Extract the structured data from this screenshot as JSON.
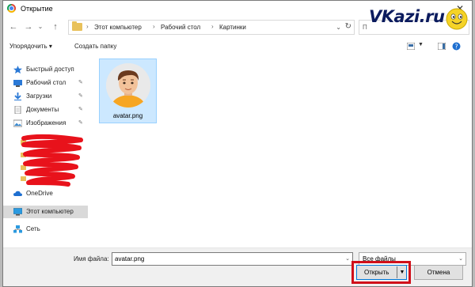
{
  "window": {
    "title": "Открытие",
    "close_glyph": "✕"
  },
  "address": {
    "crumbs": [
      "Этот компьютер",
      "Рабочий стол",
      "Картинки"
    ],
    "sep": "›",
    "search_placeholder": "П"
  },
  "toolbar": {
    "organize": "Упорядочить ▾",
    "new_folder": "Создать папку"
  },
  "nav": {
    "items": [
      {
        "label": "Быстрый доступ",
        "icon": "star-icon"
      },
      {
        "label": "Рабочий стол",
        "icon": "desktop-icon",
        "pinned": true
      },
      {
        "label": "Загрузки",
        "icon": "download-icon",
        "pinned": true
      },
      {
        "label": "Документы",
        "icon": "document-icon",
        "pinned": true
      },
      {
        "label": "Изображения",
        "icon": "pictures-icon",
        "pinned": true
      },
      {
        "label": "OneDrive",
        "icon": "cloud-icon"
      },
      {
        "label": "Этот компьютер",
        "icon": "computer-icon",
        "selected": true
      },
      {
        "label": "Сеть",
        "icon": "network-icon"
      }
    ],
    "pin_glyph": "📌"
  },
  "files": [
    {
      "name": "avatar.png",
      "selected": true
    }
  ],
  "bottom": {
    "filename_label": "Имя файла:",
    "filename_value": "avatar.png",
    "filter_value": "Все файлы",
    "open_label": "Открыть",
    "cancel_label": "Отмена"
  },
  "watermark": {
    "text": "VKazi.ru"
  },
  "colors": {
    "accent": "#0078d7",
    "selection": "#cce8ff",
    "highlight": "#d0101a"
  }
}
